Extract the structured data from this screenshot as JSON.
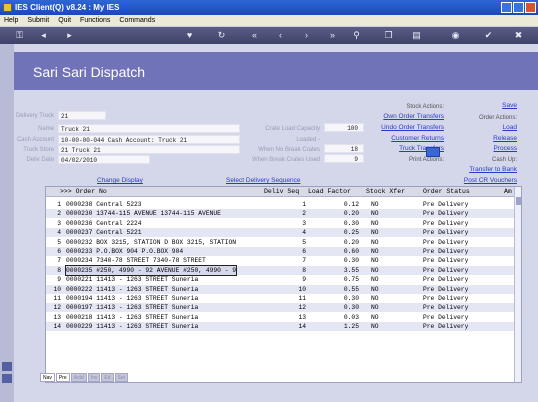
{
  "window": {
    "title": "IES Client(Q) v8.24 : My IES"
  },
  "menu": [
    "Help",
    "Submit",
    "Quit",
    "Functions",
    "Commands"
  ],
  "screen": {
    "title": "Sari Sari Dispatch"
  },
  "form": {
    "delivery_truck_label": "Delivery Truck",
    "delivery_truck": "21",
    "name_label": "Name",
    "name": "Truck 21",
    "cash_account_label": "Cash Account",
    "cash_account": "10-00-00-044 Cash Account: Truck 21",
    "truck_store_label": "Truck Store",
    "truck_store": "21 Truck 21",
    "deliv_date_label": "Deliv Date",
    "deliv_date": "04/02/2010",
    "crate_load_capacity_label": "Crate Load Capacity",
    "crate_load_capacity": "100",
    "loaded_label": "Loaded -",
    "when_no_break_label": "When No Break Crates",
    "when_no_break": "18",
    "when_break_label": "When Break Crates Used",
    "when_break": "9"
  },
  "actions": {
    "stock_actions_label": "Stock Actions:",
    "own_order_transfers": "Own Order Transfers",
    "undo_order_transfers": "Undo Order Transfers",
    "customer_returns": "Customer Returns",
    "truck_transfers": "Truck Transfers",
    "print_actions_label": "Print Actions:",
    "save": "Save",
    "order_actions_label": "Order Actions:",
    "load": "Load",
    "release": "Release",
    "process": "Process",
    "cash_up_label": "Cash Up:",
    "transfer_to_bank": "Transfer to Bank",
    "post_cr_vouchers": "Post CR Vouchers",
    "change_display": "Change Display",
    "select_delivery_sequence": "Select Delivery Sequence"
  },
  "table": {
    "headers": {
      "order": ">>> Order No",
      "seq": "Deliv Seq",
      "load": "Load Factor",
      "stock": "Stock Xfer",
      "status": "Order Status",
      "extra": "Am"
    },
    "rows": [
      {
        "n": "1",
        "order": "0000238 Central 5223",
        "seq": "1",
        "load": "0.12",
        "stock": "NO",
        "status": "Pre Delivery"
      },
      {
        "n": "2",
        "order": "0000230 13744-115 AVENUE 13744-115 AVENUE",
        "seq": "2",
        "load": "0.20",
        "stock": "NO",
        "status": "Pre Delivery"
      },
      {
        "n": "3",
        "order": "0000236 Central 2224",
        "seq": "3",
        "load": "0.30",
        "stock": "NO",
        "status": "Pre Delivery"
      },
      {
        "n": "4",
        "order": "0000237 Central 5221",
        "seq": "4",
        "load": "0.25",
        "stock": "NO",
        "status": "Pre Delivery"
      },
      {
        "n": "5",
        "order": "0000232 BOX 3215, STATION D BOX 3215, STATION",
        "seq": "5",
        "load": "0.20",
        "stock": "NO",
        "status": "Pre Delivery"
      },
      {
        "n": "6",
        "order": "0000233 P.O.BOX 904 P.O.BOX 904",
        "seq": "6",
        "load": "0.60",
        "stock": "NO",
        "status": "Pre Delivery"
      },
      {
        "n": "7",
        "order": "0000234 7340-78 STREET 7340-78 STREET",
        "seq": "7",
        "load": "0.30",
        "stock": "NO",
        "status": "Pre Delivery"
      },
      {
        "n": "8",
        "order": "0000235 #250, 4990 - 92 AVENUE #250, 4990 - 9",
        "seq": "8",
        "load": "3.55",
        "stock": "NO",
        "status": "Pre Delivery"
      },
      {
        "n": "9",
        "order": "0000221 11413 - 1263 STREET Suneria",
        "seq": "9",
        "load": "0.75",
        "stock": "NO",
        "status": "Pre Delivery"
      },
      {
        "n": "10",
        "order": "0000222 11413 - 1263 STREET Suneria",
        "seq": "10",
        "load": "0.55",
        "stock": "NO",
        "status": "Pre Delivery"
      },
      {
        "n": "11",
        "order": "0000194 11413 - 1263 STREET Suneria",
        "seq": "11",
        "load": "0.30",
        "stock": "NO",
        "status": "Pre Delivery"
      },
      {
        "n": "12",
        "order": "0000197 11413 - 1263 STREET Suneria",
        "seq": "12",
        "load": "0.30",
        "stock": "NO",
        "status": "Pre Delivery"
      },
      {
        "n": "13",
        "order": "0000218 11413 - 1263 STREET Suneria",
        "seq": "13",
        "load": "0.03",
        "stock": "NO",
        "status": "Pre Delivery"
      },
      {
        "n": "14",
        "order": "0000229 11413 - 1263 STREET Suneria",
        "seq": "14",
        "load": "1.25",
        "stock": "NO",
        "status": "Pre Delivery"
      }
    ],
    "selected_row": 8
  },
  "tabs": [
    "Nav",
    "Pre",
    "Actd",
    "Inv",
    "Ed",
    "Set"
  ],
  "icons": [
    "key-icon",
    "back-icon",
    "forward-icon",
    "heart-icon",
    "refresh-icon",
    "first-icon",
    "prev-icon",
    "next-icon",
    "last-icon",
    "search-icon",
    "copy-icon",
    "print-icon",
    "globe-icon",
    "ok-icon",
    "cancel-icon"
  ],
  "colors": {
    "header_bg": "#7173b8",
    "link": "#2a3ac8",
    "title_bar": "#2f66d6"
  }
}
